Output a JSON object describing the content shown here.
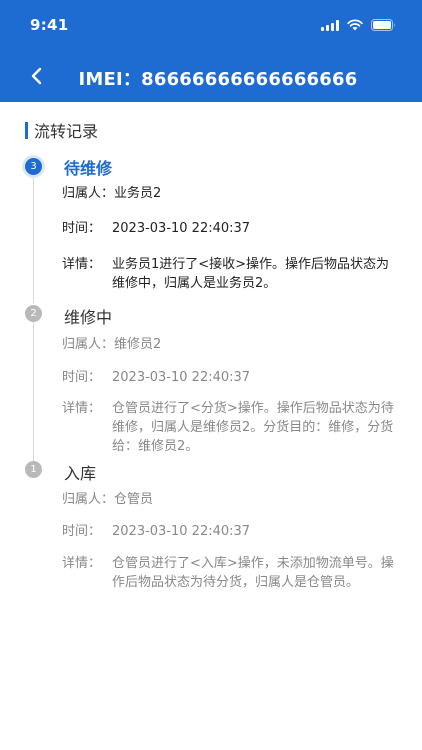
{
  "status_bar": {
    "time": "9:41"
  },
  "nav": {
    "title": "IMEI：86666666666666666"
  },
  "section": {
    "title": "流转记录"
  },
  "labels": {
    "owner": "归属人：",
    "time": "时间：",
    "detail": "详情："
  },
  "records": [
    {
      "step": "3",
      "status": "待维修",
      "owner": "业务员2",
      "time": "2023-03-10 22:40:37",
      "detail": "业务员1进行了<接收>操作。操作后物品状态为维修中，归属人是业务员2。",
      "active": true
    },
    {
      "step": "2",
      "status": "维修中",
      "owner": "维修员2",
      "time": "2023-03-10 22:40:37",
      "detail": "仓管员进行了<分货>操作。操作后物品状态为待维修，归属人是维修员2。分货目的：维修，分货给：维修员2。",
      "active": false
    },
    {
      "step": "1",
      "status": "入库",
      "owner": "仓管员",
      "time": "2023-03-10 22:40:37",
      "detail": "仓管员进行了<入库>操作，未添加物流单号。操作后物品状态为待分货，归属人是仓管员。",
      "active": false
    }
  ],
  "colors": {
    "primary": "#1e6bd1",
    "inactive_dot": "#b9b9b9"
  }
}
